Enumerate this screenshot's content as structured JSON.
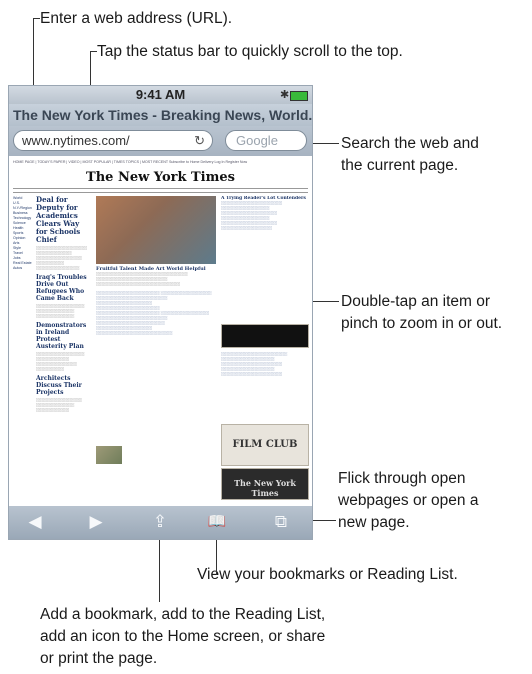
{
  "annotations": {
    "enter_url": "Enter a web address (URL).",
    "status_bar": "Tap the status bar to quickly scroll to the top.",
    "search_line1": "Search the web and",
    "search_line2": "the current page.",
    "zoom_line1": "Double-tap an item or",
    "zoom_line2": "pinch to zoom in or out.",
    "pages_line1": "Flick through open",
    "pages_line2": "webpages or open a",
    "pages_line3": "new page.",
    "bookmarks": "View your bookmarks or Reading List.",
    "share_line1": "Add a bookmark, add to the Reading List,",
    "share_line2": "add an icon to the Home screen, or share",
    "share_line3": "or print the page."
  },
  "status_bar": {
    "time": "9:41 AM",
    "bluetooth_icon": "bluetooth-icon",
    "battery_icon": "battery-icon",
    "battery_color": "#39b93a"
  },
  "browser": {
    "page_title": "The New York Times - Breaking News, World...",
    "url": "www.nytimes.com/",
    "search_placeholder": "Google",
    "toolbar": {
      "back_icon": "◀",
      "forward_icon": "▶",
      "share_icon": "⇪",
      "bookmarks_icon": "📖",
      "pages_icon": "⧉"
    }
  },
  "webpage": {
    "nav": "HOME PAGE | TODAY'S PAPER | VIDEO | MOST POPULAR | TIMES TOPICS | MOST RECENT        Subscribe to Home Delivery  Log In  Register Now",
    "logo": "The New York Times",
    "left_links": [
      "World",
      "U.S.",
      "N.Y./Region",
      "Business",
      "Technology",
      "Science",
      "Health",
      "Sports",
      "Opinion",
      "Arts",
      "Style",
      "Travel",
      "Jobs",
      "Real Estate",
      "Autos"
    ],
    "lead_headline": "Deal for Deputy for Academics Clears Way for Schools Chief",
    "second_headline": "Iraq's Troubles Drive Out Refugees Who Came Back",
    "third_headline": "Demonstrators in Ireland Protest Austerity Plan",
    "fourth_headline": "Architects Discuss Their Projects",
    "center_headline": "Fruitful Talent Made Art World Helpful",
    "opinion_headline": "A Trying Reader's Lot Contenders",
    "film_club": "FILM CLUB",
    "ad_logo": "The New York Times"
  }
}
